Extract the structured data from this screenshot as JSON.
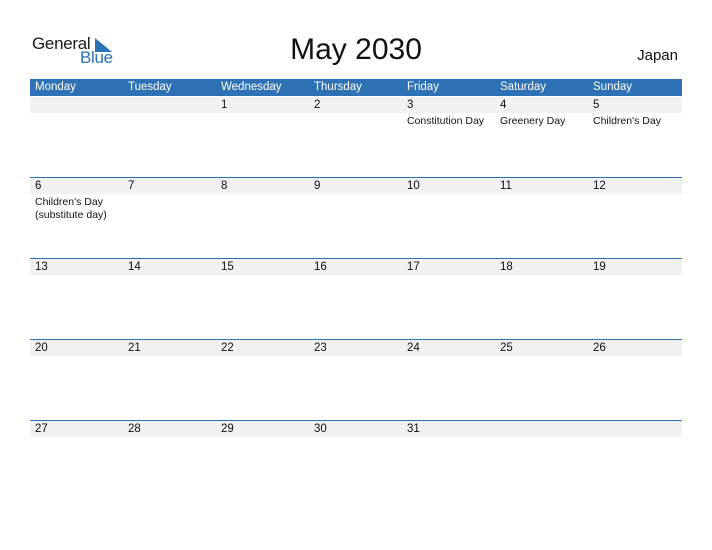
{
  "logo": {
    "part1": "General",
    "part2": "Blue"
  },
  "title": "May 2030",
  "country": "Japan",
  "weekdays": [
    "Monday",
    "Tuesday",
    "Wednesday",
    "Thursday",
    "Friday",
    "Saturday",
    "Sunday"
  ],
  "weeks": [
    [
      {
        "day": "",
        "event": ""
      },
      {
        "day": "",
        "event": ""
      },
      {
        "day": "1",
        "event": ""
      },
      {
        "day": "2",
        "event": ""
      },
      {
        "day": "3",
        "event": "Constitution Day"
      },
      {
        "day": "4",
        "event": "Greenery Day"
      },
      {
        "day": "5",
        "event": "Children's Day"
      }
    ],
    [
      {
        "day": "6",
        "event": "Children's Day\n(substitute day)"
      },
      {
        "day": "7",
        "event": ""
      },
      {
        "day": "8",
        "event": ""
      },
      {
        "day": "9",
        "event": ""
      },
      {
        "day": "10",
        "event": ""
      },
      {
        "day": "11",
        "event": ""
      },
      {
        "day": "12",
        "event": ""
      }
    ],
    [
      {
        "day": "13",
        "event": ""
      },
      {
        "day": "14",
        "event": ""
      },
      {
        "day": "15",
        "event": ""
      },
      {
        "day": "16",
        "event": ""
      },
      {
        "day": "17",
        "event": ""
      },
      {
        "day": "18",
        "event": ""
      },
      {
        "day": "19",
        "event": ""
      }
    ],
    [
      {
        "day": "20",
        "event": ""
      },
      {
        "day": "21",
        "event": ""
      },
      {
        "day": "22",
        "event": ""
      },
      {
        "day": "23",
        "event": ""
      },
      {
        "day": "24",
        "event": ""
      },
      {
        "day": "25",
        "event": ""
      },
      {
        "day": "26",
        "event": ""
      }
    ],
    [
      {
        "day": "27",
        "event": ""
      },
      {
        "day": "28",
        "event": ""
      },
      {
        "day": "29",
        "event": ""
      },
      {
        "day": "30",
        "event": ""
      },
      {
        "day": "31",
        "event": ""
      },
      {
        "day": "",
        "event": ""
      },
      {
        "day": "",
        "event": ""
      }
    ]
  ]
}
